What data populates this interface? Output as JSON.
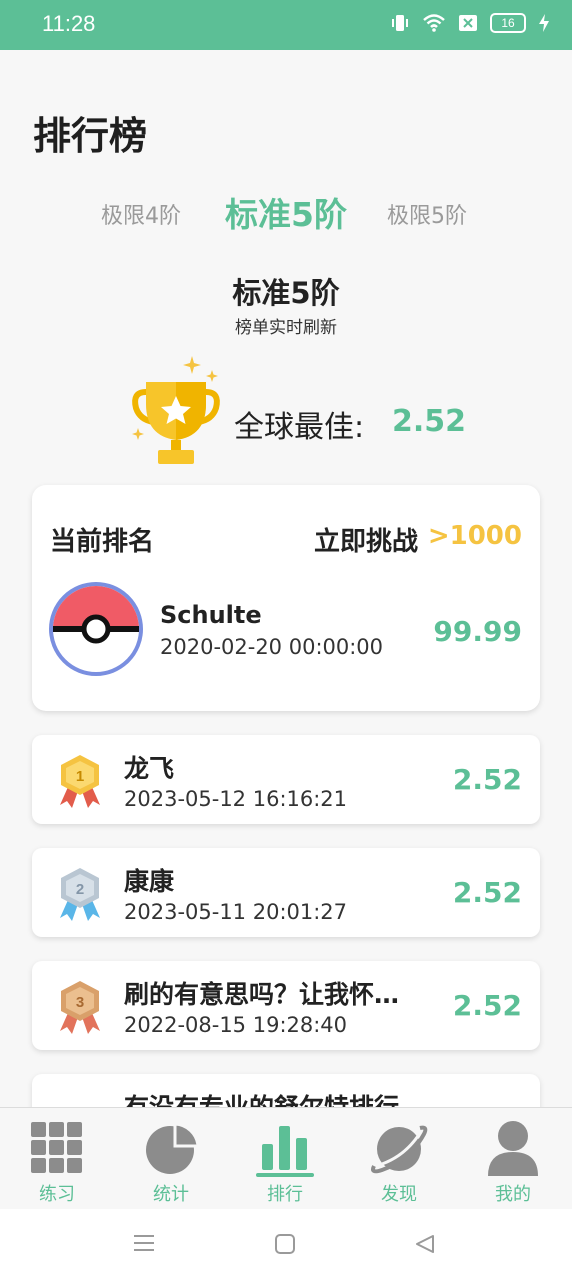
{
  "status_bar": {
    "time": "11:28",
    "battery": "16"
  },
  "page": {
    "title": "排行榜"
  },
  "tabs": [
    {
      "label": "极限4阶"
    },
    {
      "label": "标准5阶",
      "active": true
    },
    {
      "label": "极限5阶"
    }
  ],
  "section": {
    "title": "标准5阶",
    "subtitle": "榜单实时刷新"
  },
  "global_best": {
    "label": "全球最佳:",
    "value": "2.52"
  },
  "my_rank": {
    "label": "当前排名",
    "challenge": "立即挑战",
    "rank": ">1000",
    "name": "Schulte",
    "time": "2020-02-20 00:00:00",
    "score": "99.99"
  },
  "ranking": [
    {
      "name": "龙飞",
      "time": "2023-05-12 16:16:21",
      "score": "2.52",
      "medal": "1"
    },
    {
      "name": "康康",
      "time": "2023-05-11 20:01:27",
      "score": "2.52",
      "medal": "2"
    },
    {
      "name": " 刷的有意思吗？让我怀…",
      "time": "2022-08-15 19:28:40",
      "score": "2.52",
      "medal": "3"
    },
    {
      "name": "有没有专业的舒尔特排行"
    }
  ],
  "bottom_nav": [
    {
      "label": "练习",
      "icon": "grid-icon"
    },
    {
      "label": "统计",
      "icon": "pie-chart-icon"
    },
    {
      "label": "排行",
      "icon": "bar-chart-icon",
      "active": true
    },
    {
      "label": "发现",
      "icon": "planet-icon"
    },
    {
      "label": "我的",
      "icon": "user-icon"
    }
  ],
  "colors": {
    "accent": "#5cbf96",
    "rank_highlight": "#f5c341",
    "icon_gray": "#8c8c8c"
  }
}
